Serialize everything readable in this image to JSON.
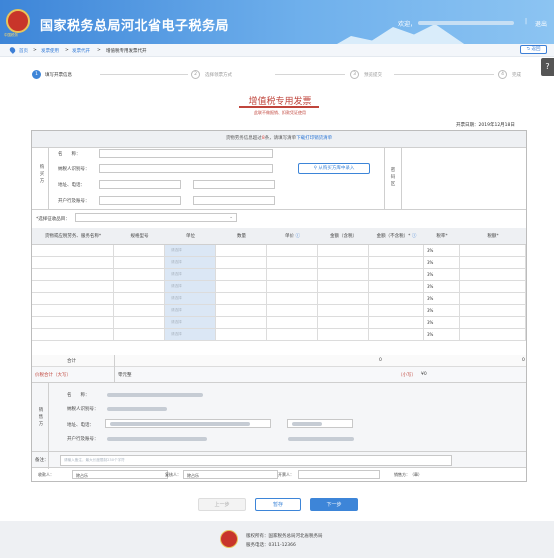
{
  "header": {
    "title": "国家税务总局河北省电子税务局",
    "logo_text": "中国税务",
    "welcome": "欢迎，",
    "separator": "|",
    "exit": "退出"
  },
  "breadcrumb": {
    "home": "首页",
    "sep": ">",
    "level1": "发票使用",
    "level2": "发票代开",
    "current": "增值税专用发票代开",
    "back": "返回"
  },
  "help_icon": "?",
  "steps": [
    {
      "num": "1",
      "label": "填写开票信息"
    },
    {
      "num": "2",
      "label": "选择领票方式"
    },
    {
      "num": "3",
      "label": "预览提交"
    },
    {
      "num": "4",
      "label": "完成"
    }
  ],
  "invoice": {
    "title": "增值税专用发票",
    "subtitle": "此联不做报销、扣款凭证使用",
    "date_label": "开票日期：",
    "date_value": "2019年12月18日"
  },
  "notice": {
    "prefix": "货物劳务信息超过",
    "count": "8",
    "suffix": "条，请填写清单",
    "link": "下载打印销货清单"
  },
  "buyer": {
    "side_label": "购买方",
    "fields": [
      "名　　称：",
      "纳税人识别号：",
      "地址、电话：",
      "开户行及账号："
    ],
    "import_button": "从购买方库中录入",
    "password_area": "密码区"
  },
  "levy": {
    "label": "*选择征收品目：",
    "value": ""
  },
  "table": {
    "headers": [
      "货物或应税劳务、服务名称*",
      "规格型号",
      "单位",
      "数量",
      "单价",
      "金额（含税）",
      "金额（不含税）*",
      "税率*",
      "税额*"
    ],
    "placeholder": "请选择",
    "rate": "3%",
    "row_count": 8
  },
  "totals": {
    "total_label": "合计",
    "total_no_tax": "0",
    "total_tax": "0",
    "caps_label": "价税合计（大写）",
    "caps_value": "零元整",
    "small_label": "（小写）",
    "small_value": "¥0"
  },
  "seller": {
    "side_label": "销售方",
    "fields": [
      "名　　称：",
      "纳税人识别号：",
      "地址、电话：",
      "开户行及账号："
    ]
  },
  "note": {
    "label": "备注：",
    "placeholder": "请输入备注，最大长度限制230个字符"
  },
  "bottom": {
    "payee_label": "收款人：",
    "payee_value": "除占乐",
    "reviewer_label": "复核人：",
    "reviewer_value": "除占乐",
    "drawer_label": "开票人：",
    "drawer_value": "",
    "seller_label": "销售方：（章）"
  },
  "buttons": {
    "prev": "上一步",
    "save": "暂存",
    "next": "下一步"
  },
  "footer": {
    "copyright": "版权所有：国家税务总局河北省税务局",
    "phone": "服务电话：0311-12366"
  },
  "colors": {
    "header": "#3d85d8",
    "accent": "#3d85d8",
    "title_red": "#c0453c",
    "cell_blue": "#dbe7f5"
  }
}
